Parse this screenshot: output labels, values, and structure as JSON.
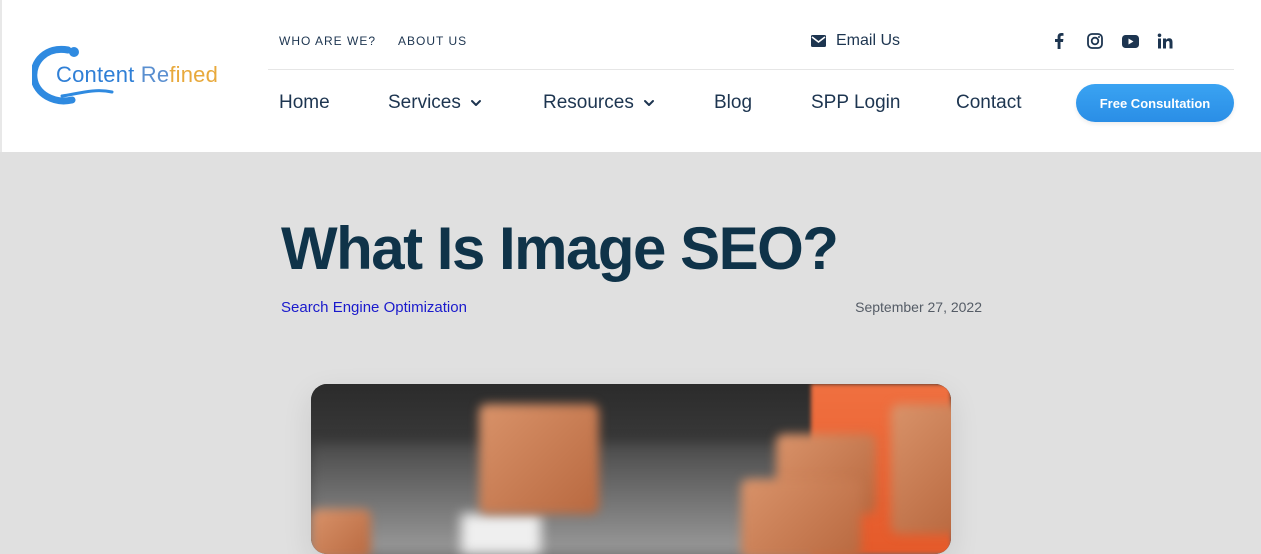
{
  "brand": {
    "name_part1": "Content",
    "name_part2": " Re",
    "name_part3": "fined"
  },
  "topbar": {
    "links": [
      "WHO ARE WE?",
      "ABOUT US"
    ],
    "email_label": "Email Us",
    "social_icons": [
      "facebook-icon",
      "instagram-icon",
      "youtube-icon",
      "linkedin-icon"
    ]
  },
  "nav": {
    "items": [
      "Home",
      "Services",
      "Resources",
      "Blog",
      "SPP Login",
      "Contact"
    ],
    "cta_label": "Free Consultation"
  },
  "article": {
    "title": "What Is Image SEO?",
    "category": "Search Engine Optimization",
    "date": "September 27, 2022"
  },
  "colors": {
    "accent_blue": "#2a8ee6",
    "heading_navy": "#0f3349",
    "link_blue": "#1a1acc",
    "page_bg": "#e0e0e0"
  }
}
